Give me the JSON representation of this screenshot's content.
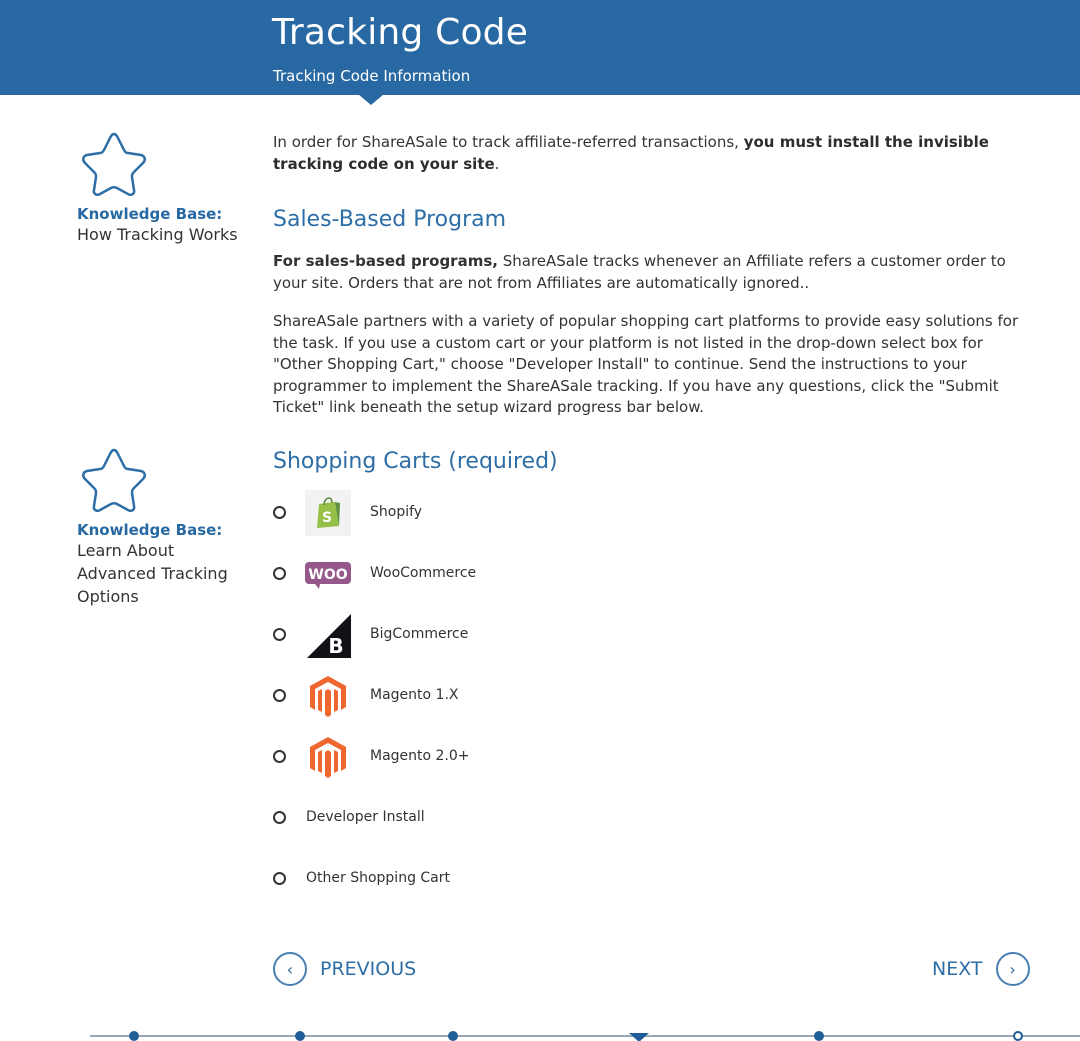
{
  "header": {
    "title": "Tracking Code",
    "subtitle": "Tracking Code Information"
  },
  "sidebar": {
    "kb1": {
      "label": "Knowledge Base:",
      "link": "How Tracking Works"
    },
    "kb2": {
      "label": "Knowledge Base:",
      "link_lines": [
        "Learn About",
        "Advanced Tracking",
        "Options"
      ]
    }
  },
  "intro": {
    "text_before": "In order for ShareASale to track affiliate-referred transactions, ",
    "text_bold": "you must install the invisible tracking code on your site",
    "text_after": "."
  },
  "sales_program": {
    "title": "Sales-Based Program",
    "p1_bold": "For sales-based programs,",
    "p1_rest": " ShareASale tracks whenever an Affiliate refers a customer order to your site. Orders that are not from Affiliates are automatically ignored..",
    "p2": "ShareASale partners with a variety of popular shopping cart platforms to provide easy solutions for the task. If you use a custom cart or your platform is not listed in the drop-down select box for \"Other Shopping Cart,\" choose \"Developer Install\" to continue. Send the instructions to your programmer to implement the ShareASale tracking. If you have any questions, click the \"Submit Ticket\" link beneath the setup wizard progress bar below."
  },
  "carts": {
    "title": "Shopping Carts (required)",
    "options": [
      {
        "label": "Shopify",
        "icon": "shopify-logo"
      },
      {
        "label": "WooCommerce",
        "icon": "woocommerce-logo"
      },
      {
        "label": "BigCommerce",
        "icon": "bigcommerce-logo"
      },
      {
        "label": "Magento 1.X",
        "icon": "magento-logo"
      },
      {
        "label": "Magento 2.0+",
        "icon": "magento-logo"
      },
      {
        "label": "Developer Install",
        "icon": ""
      },
      {
        "label": "Other Shopping Cart",
        "icon": ""
      }
    ]
  },
  "nav": {
    "previous": "PREVIOUS",
    "next": "NEXT",
    "prev_icon": "chevron-left-icon",
    "next_icon": "chevron-right-icon"
  },
  "colors": {
    "brand_blue": "#2869a3",
    "progress_blue": "#1f5d99"
  }
}
